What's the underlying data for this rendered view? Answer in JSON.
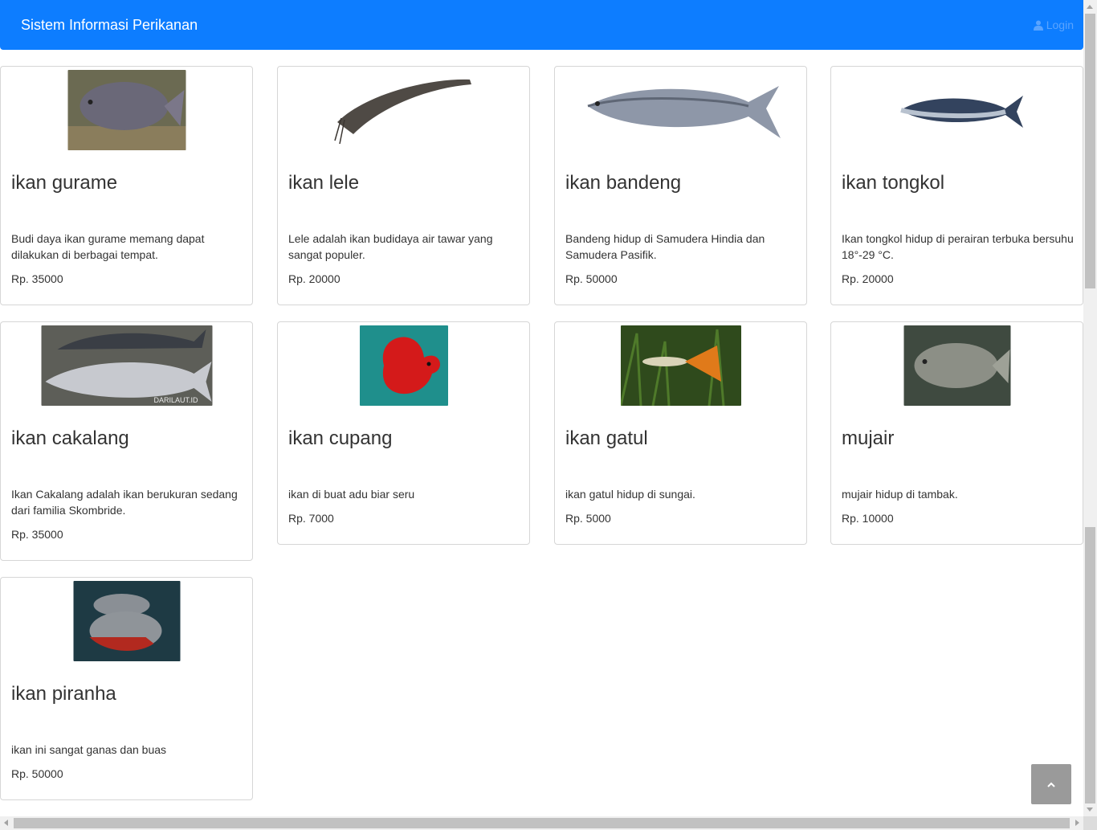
{
  "navbar": {
    "brand": "Sistem Informasi Perikanan",
    "login_label": "Login",
    "login_icon": "user-icon"
  },
  "products": [
    {
      "name": "ikan gurame",
      "description": "Budi daya ikan gurame memang dapat dilakukan di berbagai tempat.",
      "price": "Rp. 35000"
    },
    {
      "name": "ikan lele",
      "description": "Lele adalah ikan budidaya air tawar yang sangat populer.",
      "price": "Rp. 20000"
    },
    {
      "name": "ikan bandeng",
      "description": "Bandeng hidup di Samudera Hindia dan Samudera Pasifik.",
      "price": "Rp. 50000"
    },
    {
      "name": "ikan tongkol",
      "description": "Ikan tongkol hidup di perairan terbuka bersuhu 18°-29 °C.",
      "price": "Rp. 20000"
    },
    {
      "name": "ikan cakalang",
      "description": "Ikan Cakalang adalah ikan berukuran sedang dari familia Skombride.",
      "price": "Rp. 35000",
      "image_watermark": "DARILAUT.ID"
    },
    {
      "name": "ikan cupang",
      "description": "ikan di buat adu biar seru",
      "price": "Rp. 7000"
    },
    {
      "name": "ikan gatul",
      "description": "ikan gatul hidup di sungai.",
      "price": "Rp. 5000"
    },
    {
      "name": "mujair",
      "description": "mujair hidup di tambak.",
      "price": "Rp. 10000"
    },
    {
      "name": "ikan piranha",
      "description": "ikan ini sangat ganas dan buas",
      "price": "Rp. 50000"
    }
  ],
  "scroll_top_icon": "chevron-up-icon"
}
